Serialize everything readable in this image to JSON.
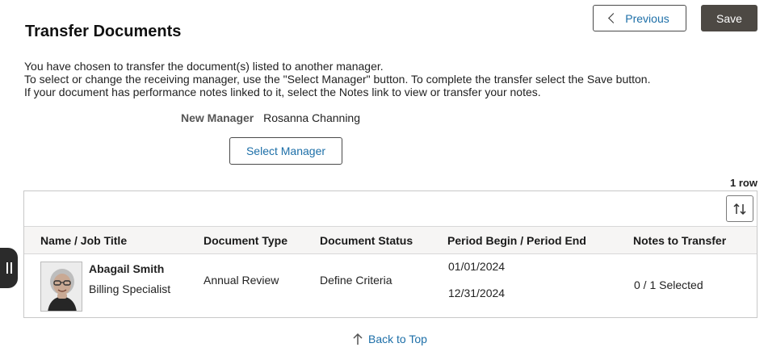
{
  "header": {
    "title": "Transfer Documents",
    "previous_label": "Previous",
    "save_label": "Save"
  },
  "instructions": [
    "You have chosen to transfer the document(s) listed to another manager.",
    "To select or change the receiving manager, use the \"Select Manager\" button. To complete the transfer select the Save button.",
    "If your document has performance notes linked to it, select the Notes link to view or transfer your notes."
  ],
  "manager": {
    "label": "New Manager",
    "value": "Rosanna Channing",
    "select_label": "Select Manager"
  },
  "grid": {
    "row_count": "1 row",
    "columns": [
      "Name / Job Title",
      "Document Type",
      "Document Status",
      "Period Begin / Period End",
      "Notes to Transfer"
    ],
    "rows": [
      {
        "name": "Abagail Smith",
        "job_title": "Billing Specialist",
        "document_type": "Annual Review",
        "document_status": "Define Criteria",
        "period_begin": "01/01/2024",
        "period_end": "12/31/2024",
        "notes": "0 / 1 Selected"
      }
    ]
  },
  "footer": {
    "back_to_top": "Back to Top"
  },
  "icons": {
    "previous": "chevron-left-icon",
    "sort": "sort-arrows-icon",
    "back_to_top": "arrow-up-icon",
    "side_panel": "panel-handle-icon"
  },
  "colors": {
    "link": "#1d6fa8",
    "primary_button": "#4d4944",
    "header_bg": "#f6f5f4"
  }
}
